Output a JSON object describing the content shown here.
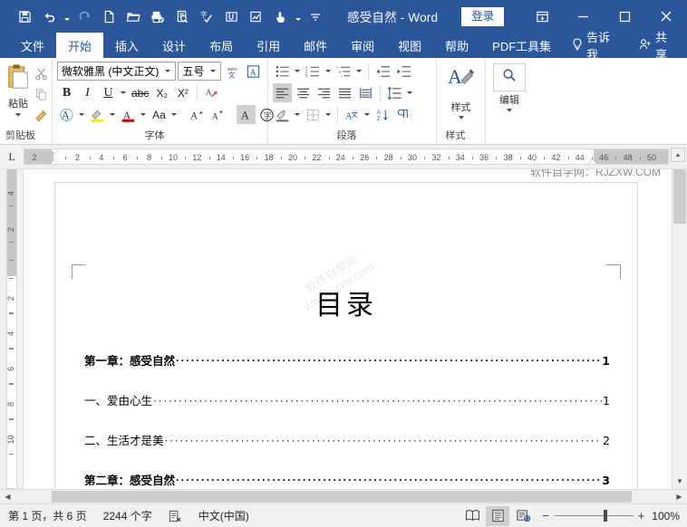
{
  "titlebar": {
    "document_title": "感受自然  -  Word",
    "signin_label": "登录",
    "qat": [
      {
        "name": "save-icon",
        "tip": "保存"
      },
      {
        "name": "undo-icon",
        "tip": "撤消"
      },
      {
        "name": "redo-icon",
        "tip": "恢复"
      },
      {
        "name": "new-document-icon",
        "tip": "新建"
      },
      {
        "name": "open-folder-icon",
        "tip": "打开"
      },
      {
        "name": "quick-print-icon",
        "tip": "快速打印"
      },
      {
        "name": "print-preview-icon",
        "tip": "打印预览"
      },
      {
        "name": "spelling-check-icon",
        "tip": "拼写和语法"
      },
      {
        "name": "attachment-icon",
        "tip": "附件"
      },
      {
        "name": "edit-chart-icon",
        "tip": "编辑图表"
      },
      {
        "name": "touch-mode-icon",
        "tip": "触摸/鼠标模式"
      },
      {
        "name": "customize-qat-icon",
        "tip": "自定义快速访问工具栏"
      }
    ],
    "window_controls": [
      {
        "name": "ribbon-display-options",
        "glyph": "⊼"
      },
      {
        "name": "minimize",
        "glyph": "–"
      },
      {
        "name": "maximize",
        "glyph": "□"
      },
      {
        "name": "close",
        "glyph": "✕"
      }
    ]
  },
  "tabs": [
    {
      "label": "文件",
      "active": false
    },
    {
      "label": "开始",
      "active": true
    },
    {
      "label": "插入",
      "active": false
    },
    {
      "label": "设计",
      "active": false
    },
    {
      "label": "布局",
      "active": false
    },
    {
      "label": "引用",
      "active": false
    },
    {
      "label": "邮件",
      "active": false
    },
    {
      "label": "审阅",
      "active": false
    },
    {
      "label": "视图",
      "active": false
    },
    {
      "label": "帮助",
      "active": false
    },
    {
      "label": "PDF工具集",
      "active": false
    }
  ],
  "tell_me": "告诉我",
  "share": "共享",
  "ribbon": {
    "clipboard": {
      "group_label": "剪贴板",
      "paste_label": "粘贴",
      "buttons": [
        "剪切",
        "复制",
        "格式刷"
      ]
    },
    "font": {
      "group_label": "字体",
      "font_name": "微软雅黑 (中文正文)",
      "font_size": "五号",
      "bold": "B",
      "italic": "I",
      "underline": "U",
      "strikethrough": "abc",
      "subscript": "X₂",
      "superscript": "X²",
      "clear_format": "清除所有格式",
      "phonetic": "拼音指南",
      "char_border": "字符边框",
      "text_effects": "文本效果",
      "highlight": "文本突出显示颜色",
      "font_color": "字体颜色",
      "change_case": "Aa",
      "grow_font": "增大字号",
      "shrink_font": "减小字号",
      "shading_char": "字符底纹",
      "enclose_char": "带圈字符"
    },
    "paragraph": {
      "group_label": "段落",
      "bullets": "项目符号",
      "numbering": "编号",
      "multilevel": "多级列表",
      "decrease_indent": "减少缩进量",
      "increase_indent": "增加缩进量",
      "align_left": "左对齐",
      "align_center": "居中",
      "align_right": "右对齐",
      "justify": "两端对齐",
      "distribute": "分散对齐",
      "line_spacing": "行和段落间距",
      "shading": "底纹",
      "borders": "边框",
      "asian_layout": "中文版式",
      "sort": "排序",
      "show_marks": "显示/隐藏编辑标记"
    },
    "styles": {
      "group_label": "样式",
      "button_label": "样式"
    },
    "editing": {
      "group_label": "",
      "button_label": "编辑"
    }
  },
  "ruler": {
    "tab_stop_marker": "L",
    "h_left_margin_label": "2",
    "h_ticks": [
      "2",
      "4",
      "6",
      "8",
      "10",
      "12",
      "14",
      "16",
      "18",
      "20",
      "22",
      "24",
      "26",
      "28",
      "30",
      "32",
      "34",
      "36",
      "38",
      "40",
      "42",
      "44",
      "46",
      "48",
      "50"
    ],
    "v_margin_ticks": [
      "4",
      "2"
    ],
    "v_ticks": [
      "2",
      "4",
      "6",
      "8",
      "10"
    ]
  },
  "document": {
    "watermark_corner": "软件自学网：RJZXW.COM",
    "page_watermark": "软件自学网\nwww.rjzxw.com",
    "title": "目录",
    "toc": [
      {
        "text": "第一章：感受自然",
        "page": "1",
        "level": 1
      },
      {
        "text": "一、爱由心生",
        "page": "1",
        "level": 2
      },
      {
        "text": "二、生活才是美",
        "page": "2",
        "level": 2
      },
      {
        "text": "第二章：感受自然",
        "page": "3",
        "level": 1
      }
    ]
  },
  "statusbar": {
    "page_info": "第 1 页，共 6 页",
    "word_count": "2244 个字",
    "proofing_icon": "校对错误",
    "language": "中文(中国)",
    "views": [
      {
        "name": "read-mode-view",
        "active": false
      },
      {
        "name": "print-layout-view",
        "active": true
      },
      {
        "name": "web-layout-view",
        "active": false
      }
    ],
    "zoom_out": "−",
    "zoom_in": "+",
    "zoom_level": "100%"
  },
  "colors": {
    "brand_blue": "#2b579a",
    "ribbon_bg": "#ffffff",
    "status_bg": "#f0f0f0",
    "doc_bg": "#868686"
  }
}
